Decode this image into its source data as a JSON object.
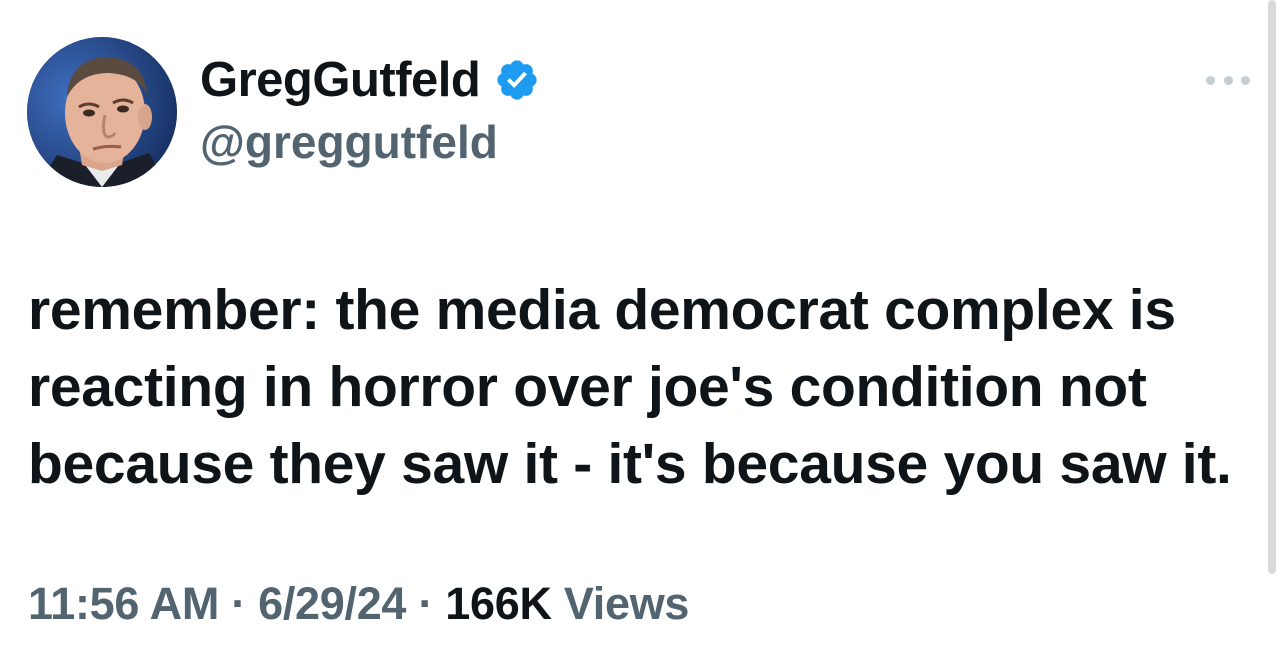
{
  "tweet": {
    "author": {
      "display_name": "GregGutfeld",
      "handle": "@greggutfeld",
      "verified": true,
      "avatar": "profile-photo"
    },
    "more_icon": "more-horizontal-icon",
    "text": "remember: the media democrat complex is reacting in horror over joe's condition not because they saw it - it's because you saw it.",
    "time": "11:56 AM",
    "separator": "·",
    "date": "6/29/24",
    "views_count": "166K",
    "views_label": "Views"
  },
  "colors": {
    "text_primary": "#0f1419",
    "text_secondary": "#536471",
    "verified_blue": "#1d9bf0"
  }
}
